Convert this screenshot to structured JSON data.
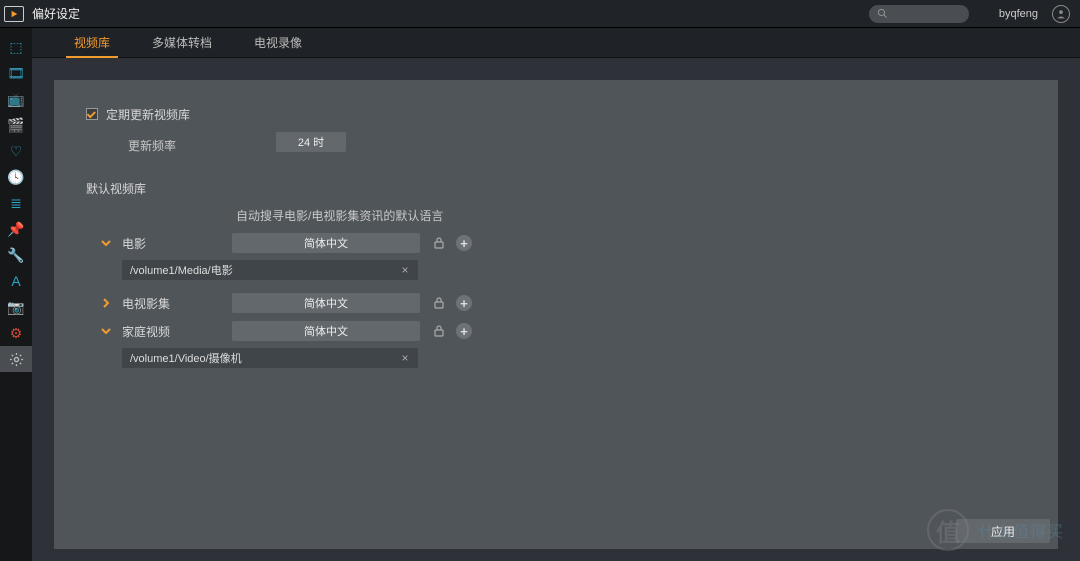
{
  "header": {
    "title": "偏好设定",
    "username": "byqfeng"
  },
  "sidebar": {
    "items": [
      {
        "name": "overview-icon"
      },
      {
        "name": "movie-icon"
      },
      {
        "name": "tv-icon"
      },
      {
        "name": "video-library-icon"
      },
      {
        "name": "favorite-icon"
      },
      {
        "name": "history-icon"
      },
      {
        "name": "playlist-icon"
      },
      {
        "name": "link-icon"
      },
      {
        "name": "tool-icon"
      },
      {
        "name": "text-icon"
      },
      {
        "name": "photo-icon"
      },
      {
        "name": "voice-icon"
      },
      {
        "name": "settings-icon"
      }
    ],
    "activeIndex": 12
  },
  "tabs": {
    "items": [
      "视频库",
      "多媒体转档",
      "电视录像"
    ],
    "activeIndex": 0
  },
  "form": {
    "autoUpdate": {
      "checked": true,
      "label": "定期更新视频库"
    },
    "freq": {
      "label": "更新频率",
      "value": "24 时"
    },
    "defaultLibTitle": "默认视频库",
    "langHint": "自动搜寻电影/电视影集资讯的默认语言",
    "libs": [
      {
        "name": "电影",
        "expanded": true,
        "lang": "简体中文",
        "paths": [
          "/volume1/Media/电影"
        ]
      },
      {
        "name": "电视影集",
        "expanded": false,
        "lang": "简体中文",
        "paths": []
      },
      {
        "name": "家庭视频",
        "expanded": true,
        "lang": "简体中文",
        "paths": [
          "/volume1/Video/摄像机"
        ]
      }
    ]
  },
  "footer": {
    "apply": "应用"
  },
  "watermark": {
    "circle": "值",
    "text": "什么值得买"
  }
}
